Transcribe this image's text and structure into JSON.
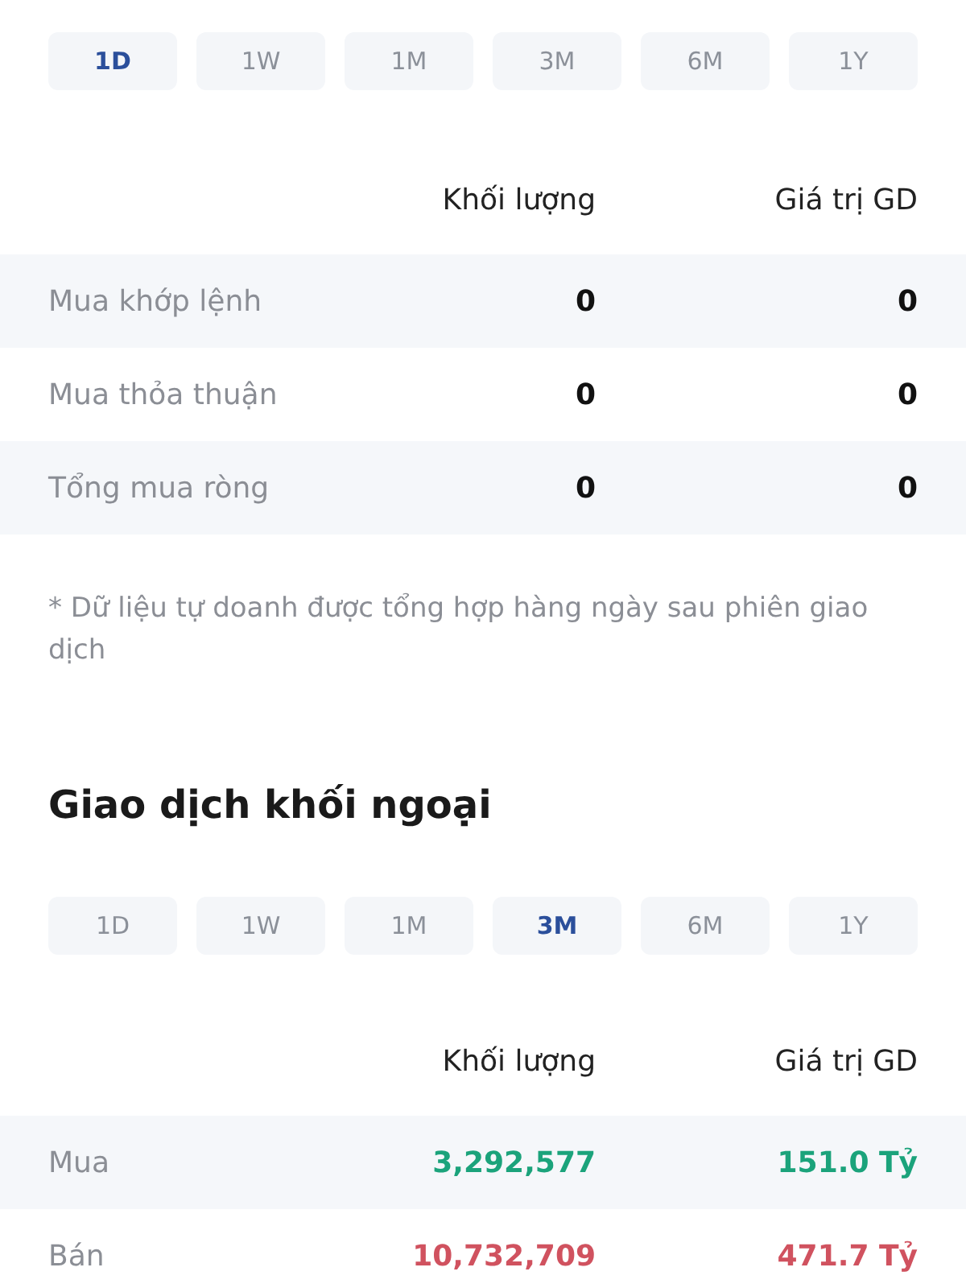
{
  "proprietary_trading": {
    "periods": [
      {
        "label": "1D",
        "selected": true
      },
      {
        "label": "1W",
        "selected": false
      },
      {
        "label": "1M",
        "selected": false
      },
      {
        "label": "3M",
        "selected": false
      },
      {
        "label": "6M",
        "selected": false
      },
      {
        "label": "1Y",
        "selected": false
      }
    ],
    "columns": [
      "Khối lượng",
      "Giá trị GD"
    ],
    "rows": [
      {
        "label": "Mua khớp lệnh",
        "volume": "0",
        "value": "0"
      },
      {
        "label": "Mua thỏa thuận",
        "volume": "0",
        "value": "0"
      },
      {
        "label": "Tổng mua ròng",
        "volume": "0",
        "value": "0"
      }
    ],
    "note": "* Dữ liệu tự doanh được tổng hợp hàng ngày sau phiên giao dịch"
  },
  "foreign_trading": {
    "title": "Giao dịch khối ngoại",
    "periods": [
      {
        "label": "1D",
        "selected": false
      },
      {
        "label": "1W",
        "selected": false
      },
      {
        "label": "1M",
        "selected": false
      },
      {
        "label": "3M",
        "selected": true
      },
      {
        "label": "6M",
        "selected": false
      },
      {
        "label": "1Y",
        "selected": false
      }
    ],
    "columns": [
      "Khối lượng",
      "Giá trị GD"
    ],
    "rows": [
      {
        "label": "Mua",
        "volume": "3,292,577",
        "value": "151.0 Tỷ",
        "color": "#1ba37b"
      },
      {
        "label": "Bán",
        "volume": "10,732,709",
        "value": "471.7 Tỷ",
        "color": "#d0525f"
      }
    ]
  }
}
